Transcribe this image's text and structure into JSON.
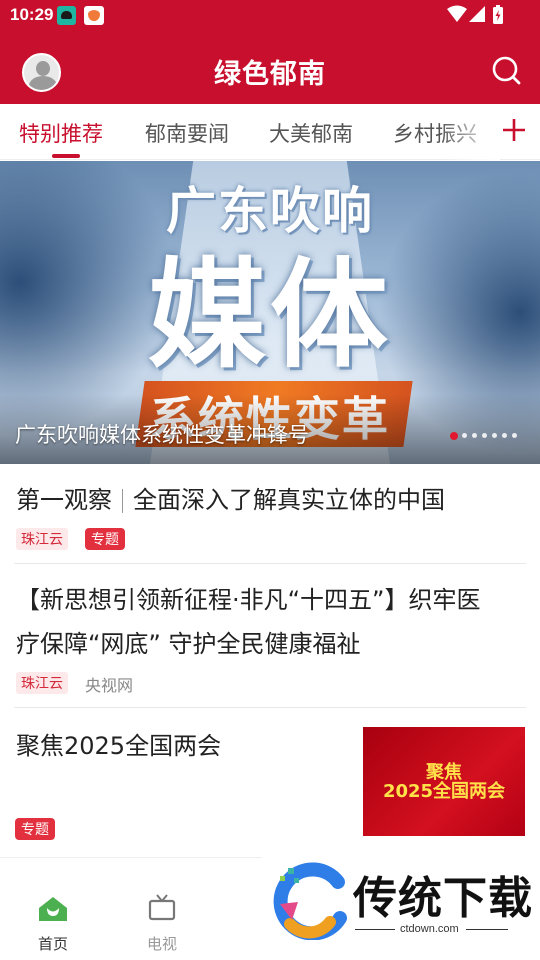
{
  "status_bar": {
    "time": "10:29"
  },
  "header": {
    "title": "绿色郁南"
  },
  "tabs": [
    {
      "label": "特别推荐",
      "active": true
    },
    {
      "label": "郁南要闻"
    },
    {
      "label": "大美郁南"
    },
    {
      "label": "乡村振兴"
    }
  ],
  "banner": {
    "caption": "广东吹响媒体系统性变革冲锋号",
    "art_line1": "广东吹响",
    "art_line2": "媒体",
    "art_line3": "系统性变革",
    "slide_count": 7,
    "active_slide": 1
  },
  "articles": [
    {
      "title_a": "第一观察",
      "title_b": "全面深入了解真实立体的中国",
      "source_tag": "珠江云",
      "topic_tag": "专题"
    },
    {
      "title_line1": "【新思想引领新征程·非凡“十四五”】织牢医",
      "title_line2": "疗保障“网底” 守护全民健康福祉",
      "source_tag": "珠江云",
      "source": "央视网"
    },
    {
      "title": "聚焦2025全国两会",
      "topic_tag": "专题",
      "thumb_line1": "聚焦",
      "thumb_line2": "2025全国两会"
    }
  ],
  "bottom_nav": [
    {
      "label": "首页",
      "active": true
    },
    {
      "label": "电视"
    }
  ],
  "watermark": {
    "text": "传统下载",
    "url": "ctdown.com"
  },
  "colors": {
    "brand_red": "#c8102e",
    "accent_red": "#e2303f",
    "home_green": "#4caf50"
  }
}
